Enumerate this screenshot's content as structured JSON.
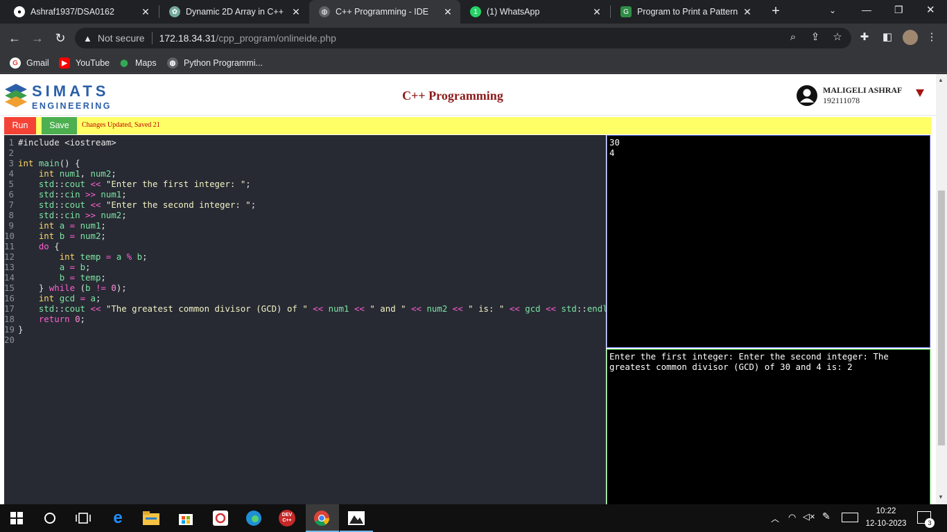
{
  "browser": {
    "tabs": [
      {
        "title": "Ashraf1937/DSA0162",
        "icon": "github-icon"
      },
      {
        "title": "Dynamic 2D Array in C++",
        "icon": "openai-icon"
      },
      {
        "title": "C++ Programming - IDE",
        "icon": "globe-icon",
        "active": true
      },
      {
        "title": "(1) WhatsApp",
        "icon": "whatsapp-icon"
      },
      {
        "title": "Program to Print a Pattern o",
        "icon": "gfg-icon"
      }
    ],
    "new_tab_symbol": "+",
    "address": {
      "security_label": "Not secure",
      "host": "172.18.34.31",
      "path": "/cpp_program/onlineide.php"
    },
    "bookmarks": [
      "Gmail",
      "YouTube",
      "Maps",
      "Python Programmi..."
    ]
  },
  "page": {
    "logo_word": "SIMATS",
    "logo_sub": "ENGINEERING",
    "title": "C++ Programming",
    "user": {
      "name": "MALIGELI ASHRAF",
      "id": "192111078"
    },
    "toolbar": {
      "run_label": "Run",
      "save_label": "Save",
      "status": "Changes Updated, Saved 21"
    },
    "input_text": "30\n4",
    "output_text": "Enter the first integer: Enter the second integer: The\ngreatest common divisor (GCD) of 30 and 4 is: 2"
  },
  "code_lines": [
    "#include <iostream>",
    "",
    "int main() {",
    "    int num1, num2;",
    "    std::cout << \"Enter the first integer: \";",
    "    std::cin >> num1;",
    "    std::cout << \"Enter the second integer: \";",
    "    std::cin >> num2;",
    "    int a = num1;",
    "    int b = num2;",
    "    do {",
    "        int temp = a % b;",
    "        a = b;",
    "        b = temp;",
    "    } while (b != 0);",
    "    int gcd = a;",
    "    std::cout << \"The greatest common divisor (GCD) of \" << num1 << \" and \" << num2 << \" is: \" << gcd << std::endl;",
    "    return 0;",
    "}",
    ""
  ],
  "taskbar": {
    "time": "10:22",
    "date": "12-10-2023",
    "notification_count": "3",
    "dev_label": "DEV",
    "dev_sub": "C++"
  }
}
